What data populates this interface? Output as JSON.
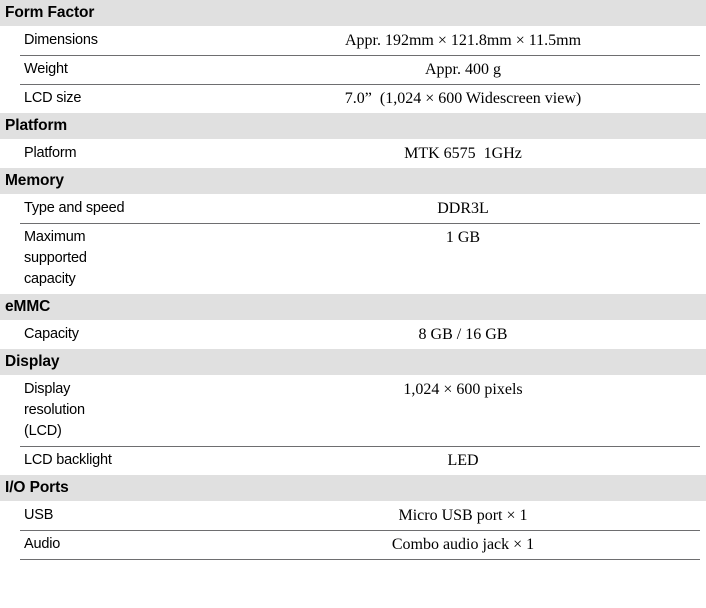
{
  "document": {
    "type": "specification-table",
    "colors": {
      "section_header_background": "#e0e0e0",
      "rule": "#6e6e70",
      "text": "#000000",
      "page_background": "#ffffff"
    }
  },
  "sections": [
    {
      "title": "Form Factor",
      "rows": [
        {
          "label": "Dimensions",
          "value": "Appr. 192mm × 121.8mm × 11.5mm"
        },
        {
          "label": "Weight",
          "value": "Appr. 400 g"
        },
        {
          "label": "LCD size",
          "value": "7.0”  (1,024 × 600 Widescreen view)"
        }
      ]
    },
    {
      "title": "Platform",
      "rows": [
        {
          "label": "Platform",
          "value": "MTK 6575  1GHz"
        }
      ]
    },
    {
      "title": "Memory",
      "rows": [
        {
          "label": "Type and speed",
          "value": "DDR3L"
        },
        {
          "label": "Maximum\nsupported\ncapacity",
          "value": "1 GB"
        }
      ]
    },
    {
      "title": "eMMC",
      "rows": [
        {
          "label": "Capacity",
          "value": "8 GB / 16 GB"
        }
      ]
    },
    {
      "title": "Display",
      "rows": [
        {
          "label": "Display\nresolution\n(LCD)",
          "value": "1,024 × 600 pixels"
        },
        {
          "label": "LCD backlight",
          "value": "LED"
        }
      ]
    },
    {
      "title": "I/O Ports",
      "rows": [
        {
          "label": "USB",
          "value": "Micro USB port × 1"
        },
        {
          "label": "Audio",
          "value": "Combo audio jack × 1"
        }
      ]
    }
  ]
}
